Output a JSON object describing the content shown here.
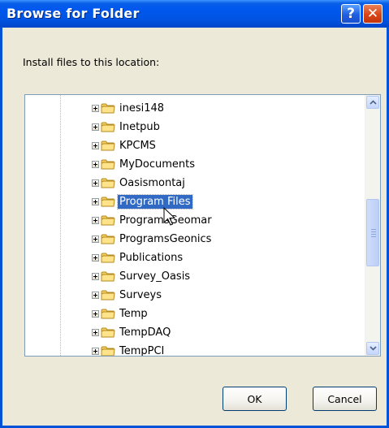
{
  "window": {
    "title": "Browse for Folder",
    "help_icon": "?",
    "close_icon": "✕"
  },
  "instruction": "Install files to this location:",
  "tree": {
    "items": [
      {
        "label": "inesi148",
        "icon": "folder-icon"
      },
      {
        "label": "Inetpub",
        "icon": "folder-icon"
      },
      {
        "label": "KPCMS",
        "icon": "folder-icon"
      },
      {
        "label": "MyDocuments",
        "icon": "folder-icon"
      },
      {
        "label": "Oasismontaj",
        "icon": "folder-icon"
      },
      {
        "label": "Program Files",
        "icon": "folder-icon",
        "selected": true
      },
      {
        "label": "ProgramsGeomar",
        "icon": "folder-icon"
      },
      {
        "label": "ProgramsGeonics",
        "icon": "folder-icon"
      },
      {
        "label": "Publications",
        "icon": "folder-icon"
      },
      {
        "label": "Survey_Oasis",
        "icon": "folder-icon"
      },
      {
        "label": "Surveys",
        "icon": "folder-icon"
      },
      {
        "label": "Temp",
        "icon": "folder-icon"
      },
      {
        "label": "TempDAQ",
        "icon": "folder-icon"
      },
      {
        "label": "TempPCI",
        "icon": "folder-icon"
      }
    ]
  },
  "buttons": {
    "ok_label": "OK",
    "cancel_label": "Cancel"
  },
  "colors": {
    "title_bar": "#0054e3",
    "selection": "#316ac5",
    "close_button": "#d94516"
  }
}
